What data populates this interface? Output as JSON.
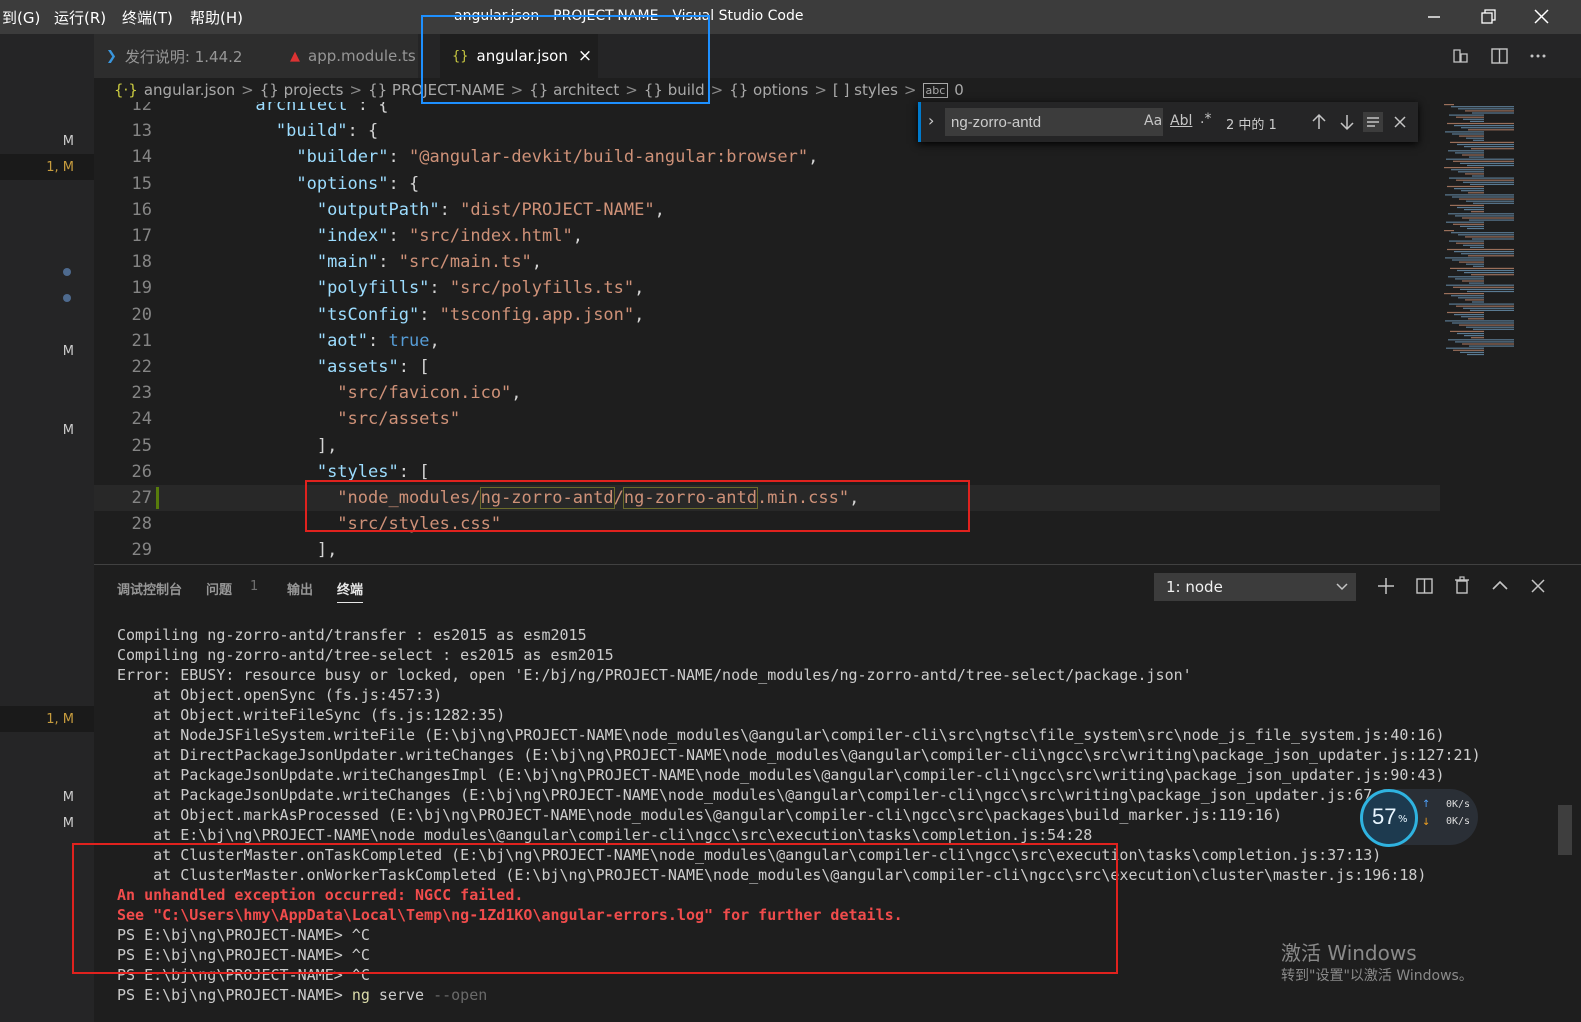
{
  "titlebar": {
    "menu": [
      "到(G)",
      "运行(R)",
      "终端(T)",
      "帮助(H)"
    ],
    "title": "angular.json - PROJECT-NAME - Visual Studio Code"
  },
  "tabs": [
    {
      "label": "发行说明: 1.44.2",
      "icon": "vscode-icon"
    },
    {
      "label": "app.module.ts",
      "icon": "angular-icon"
    },
    {
      "label": "angular.json",
      "icon": "json-icon",
      "close": "×"
    }
  ],
  "breadcrumbs": {
    "file": "angular.json",
    "items": [
      "{} projects",
      "{} PROJECT-NAME",
      "{} architect",
      "{} build",
      "{} options",
      "[ ] styles",
      "0"
    ],
    "sep": ">"
  },
  "gutter_decorations": [
    {
      "text": "M",
      "color": "#6c8ebf"
    },
    {
      "text": "1, M",
      "color": "#c79c3e"
    },
    {
      "text": "M",
      "color": "#6c8ebf"
    },
    {
      "text": "M",
      "color": "#6c8ebf"
    },
    {
      "text": "1, M",
      "color": "#c79c3e"
    },
    {
      "text": "M",
      "color": "#6c8ebf"
    },
    {
      "text": "M",
      "color": "#6c8ebf"
    }
  ],
  "editor": {
    "lines": [
      {
        "n": "12",
        "indent": "      ",
        "parts": [
          [
            "k",
            "architect"
          ],
          [
            "p",
            " : {"
          ]
        ]
      },
      {
        "n": "13",
        "indent": "        ",
        "parts": [
          [
            "k",
            "\"build\""
          ],
          [
            "p",
            ": {"
          ]
        ]
      },
      {
        "n": "14",
        "indent": "          ",
        "parts": [
          [
            "k",
            "\"builder\""
          ],
          [
            "p",
            ": "
          ],
          [
            "s",
            "\"@angular-devkit/build-angular:browser\""
          ],
          [
            "p",
            ","
          ]
        ]
      },
      {
        "n": "15",
        "indent": "          ",
        "parts": [
          [
            "k",
            "\"options\""
          ],
          [
            "p",
            ": {"
          ]
        ]
      },
      {
        "n": "16",
        "indent": "            ",
        "parts": [
          [
            "k",
            "\"outputPath\""
          ],
          [
            "p",
            ": "
          ],
          [
            "s",
            "\"dist/PROJECT-NAME\""
          ],
          [
            "p",
            ","
          ]
        ]
      },
      {
        "n": "17",
        "indent": "            ",
        "parts": [
          [
            "k",
            "\"index\""
          ],
          [
            "p",
            ": "
          ],
          [
            "s",
            "\"src/index.html\""
          ],
          [
            "p",
            ","
          ]
        ]
      },
      {
        "n": "18",
        "indent": "            ",
        "parts": [
          [
            "k",
            "\"main\""
          ],
          [
            "p",
            ": "
          ],
          [
            "s",
            "\"src/main.ts\""
          ],
          [
            "p",
            ","
          ]
        ]
      },
      {
        "n": "19",
        "indent": "            ",
        "parts": [
          [
            "k",
            "\"polyfills\""
          ],
          [
            "p",
            ": "
          ],
          [
            "s",
            "\"src/polyfills.ts\""
          ],
          [
            "p",
            ","
          ]
        ]
      },
      {
        "n": "20",
        "indent": "            ",
        "parts": [
          [
            "k",
            "\"tsConfig\""
          ],
          [
            "p",
            ": "
          ],
          [
            "s",
            "\"tsconfig.app.json\""
          ],
          [
            "p",
            ","
          ]
        ]
      },
      {
        "n": "21",
        "indent": "            ",
        "parts": [
          [
            "k",
            "\"aot\""
          ],
          [
            "p",
            ": "
          ],
          [
            "b",
            "true"
          ],
          [
            "p",
            ","
          ]
        ]
      },
      {
        "n": "22",
        "indent": "            ",
        "parts": [
          [
            "k",
            "\"assets\""
          ],
          [
            "p",
            ": ["
          ]
        ]
      },
      {
        "n": "23",
        "indent": "              ",
        "parts": [
          [
            "s",
            "\"src/favicon.ico\""
          ],
          [
            "p",
            ","
          ]
        ]
      },
      {
        "n": "24",
        "indent": "              ",
        "parts": [
          [
            "s",
            "\"src/assets\""
          ]
        ]
      },
      {
        "n": "25",
        "indent": "            ",
        "parts": [
          [
            "p",
            "],"
          ]
        ]
      },
      {
        "n": "26",
        "indent": "            ",
        "parts": [
          [
            "k",
            "\"styles\""
          ],
          [
            "p",
            ": ["
          ]
        ]
      },
      {
        "n": "27",
        "indent": "              ",
        "parts": [
          [
            "s",
            "\"node_modules/"
          ],
          [
            "s",
            "ng-zorro-antd"
          ],
          [
            "s",
            "/"
          ],
          [
            "s",
            "ng-zorro-antd"
          ],
          [
            "s",
            ".min.css\""
          ],
          [
            "p",
            ","
          ]
        ]
      },
      {
        "n": "28",
        "indent": "              ",
        "parts": [
          [
            "s",
            "\"src/styles.css\""
          ]
        ]
      },
      {
        "n": "29",
        "indent": "            ",
        "parts": [
          [
            "p",
            "],"
          ]
        ]
      }
    ]
  },
  "find": {
    "value": "ng-zorro-antd",
    "match_case": "Aa",
    "whole_word": "Abl",
    "regex": ".*",
    "count": "2 中的 1"
  },
  "panel": {
    "tabs": [
      "调试控制台",
      "问题",
      "输出",
      "终端"
    ],
    "problems_count": "1",
    "terminal_select": "1: node",
    "lines": [
      {
        "t": "Compiling ng-zorro-antd/transfer : es2015 as esm2015",
        "err": false
      },
      {
        "t": "Compiling ng-zorro-antd/tree-select : es2015 as esm2015",
        "err": false
      },
      {
        "t": "Error: EBUSY: resource busy or locked, open 'E:/bj/ng/PROJECT-NAME/node_modules/ng-zorro-antd/tree-select/package.json'",
        "err": false
      },
      {
        "t": "    at Object.openSync (fs.js:457:3)",
        "err": false
      },
      {
        "t": "    at Object.writeFileSync (fs.js:1282:35)",
        "err": false
      },
      {
        "t": "    at NodeJSFileSystem.writeFile (E:\\bj\\ng\\PROJECT-NAME\\node_modules\\@angular\\compiler-cli\\src\\ngtsc\\file_system\\src\\node_js_file_system.js:40:16)",
        "err": false
      },
      {
        "t": "    at DirectPackageJsonUpdater.writeChanges (E:\\bj\\ng\\PROJECT-NAME\\node_modules\\@angular\\compiler-cli\\ngcc\\src\\writing\\package_json_updater.js:127:21)",
        "err": false
      },
      {
        "t": "    at PackageJsonUpdate.writeChangesImpl (E:\\bj\\ng\\PROJECT-NAME\\node_modules\\@angular\\compiler-cli\\ngcc\\src\\writing\\package_json_updater.js:90:43)",
        "err": false
      },
      {
        "t": "    at PackageJsonUpdate.writeChanges (E:\\bj\\ng\\PROJECT-NAME\\node_modules\\@angular\\compiler-cli\\ngcc\\src\\writing\\package_json_updater.js:67:1",
        "err": false
      },
      {
        "t": "    at Object.markAsProcessed (E:\\bj\\ng\\PROJECT-NAME\\node_modules\\@angular\\compiler-cli\\ngcc\\src\\packages\\build_marker.js:119:16)",
        "err": false
      },
      {
        "t": "    at E:\\bj\\ng\\PROJECT-NAME\\node_modules\\@angular\\compiler-cli\\ngcc\\src\\execution\\tasks\\completion.js:54:28",
        "err": false
      },
      {
        "t": "    at ClusterMaster.onTaskCompleted (E:\\bj\\ng\\PROJECT-NAME\\node_modules\\@angular\\compiler-cli\\ngcc\\src\\execution\\tasks\\completion.js:37:13)",
        "err": false
      },
      {
        "t": "    at ClusterMaster.onWorkerTaskCompleted (E:\\bj\\ng\\PROJECT-NAME\\node_modules\\@angular\\compiler-cli\\ngcc\\src\\execution\\cluster\\master.js:196:18)",
        "err": false
      },
      {
        "t": "An unhandled exception occurred: NGCC failed.",
        "err": true
      },
      {
        "t": "See \"C:\\Users\\hmy\\AppData\\Local\\Temp\\ng-1Zd1KO\\angular-errors.log\" for further details.",
        "err": true
      },
      {
        "t": "PS E:\\bj\\ng\\PROJECT-NAME> ^C",
        "err": false
      },
      {
        "t": "PS E:\\bj\\ng\\PROJECT-NAME> ^C",
        "err": false
      },
      {
        "t": "PS E:\\bj\\ng\\PROJECT-NAME> ^C",
        "err": false
      },
      {
        "t": "PS E:\\bj\\ng\\PROJECT-NAME> ng serve --open",
        "err": false
      }
    ]
  },
  "net_widget": {
    "cpu": "57",
    "unit": "%",
    "up": "0K/s",
    "down": "0K/s"
  },
  "watermark": {
    "line1": "激活 Windows",
    "line2": "转到\"设置\"以激活 Windows。"
  },
  "colors": {
    "accent": "#007acc",
    "annotation_red": "#e0221e",
    "annotation_blue": "#1e90ff",
    "error_text": "#f14c4c"
  }
}
